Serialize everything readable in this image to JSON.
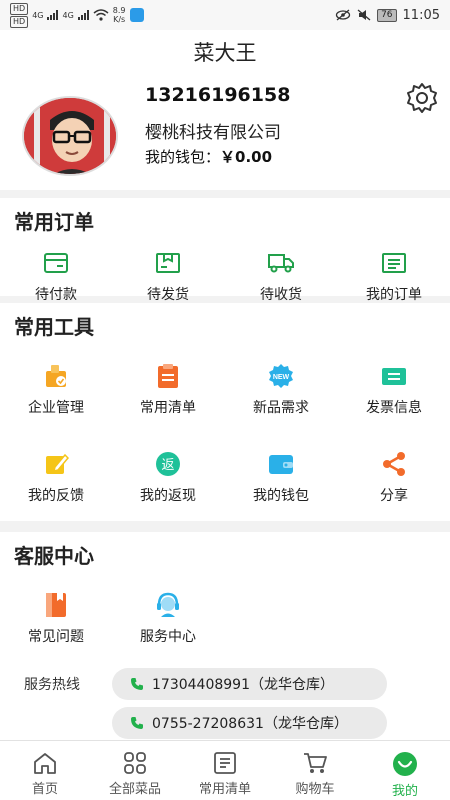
{
  "status_bar": {
    "chip1": "HD",
    "chip2": "HD",
    "net1": "4G",
    "net2": "4G",
    "speed_value": "8.9",
    "speed_unit": "K/s",
    "battery": "76",
    "time": "11:05"
  },
  "header": {
    "title": "菜大王"
  },
  "profile": {
    "phone": "13216196158",
    "company": "樱桃科技有限公司",
    "wallet_label": "我的钱包：",
    "wallet_amount": "￥0.00"
  },
  "orders": {
    "title": "常用订单",
    "items": [
      {
        "label": "待付款",
        "icon": "payment-icon"
      },
      {
        "label": "待发货",
        "icon": "package-icon"
      },
      {
        "label": "待收货",
        "icon": "truck-icon"
      },
      {
        "label": "我的订单",
        "icon": "order-list-icon"
      }
    ]
  },
  "tools": {
    "title": "常用工具",
    "items": [
      {
        "label": "企业管理",
        "icon": "enterprise-icon",
        "color": "#f5a623"
      },
      {
        "label": "常用清单",
        "icon": "clipboard-icon",
        "color": "#f26b2b"
      },
      {
        "label": "新品需求",
        "icon": "new-badge-icon",
        "color": "#2ab0e8"
      },
      {
        "label": "发票信息",
        "icon": "invoice-icon",
        "color": "#1fc199"
      },
      {
        "label": "我的反馈",
        "icon": "feedback-icon",
        "color": "#f5c518"
      },
      {
        "label": "我的返现",
        "icon": "cashback-icon",
        "color": "#1fc199"
      },
      {
        "label": "我的钱包",
        "icon": "wallet-icon",
        "color": "#2ab0e8"
      },
      {
        "label": "分享",
        "icon": "share-icon",
        "color": "#f26b2b"
      }
    ]
  },
  "service": {
    "title": "客服中心",
    "items": [
      {
        "label": "常见问题",
        "icon": "faq-book-icon",
        "color": "#f26b2b"
      },
      {
        "label": "服务中心",
        "icon": "customer-service-icon",
        "color": "#2ab0e8"
      }
    ],
    "hotline_label": "服务热线",
    "hotlines": [
      "17304408991（龙华仓库）",
      "0755-27208631（龙华仓库）"
    ]
  },
  "tab_bar": {
    "items": [
      {
        "label": "首页",
        "icon": "home-icon"
      },
      {
        "label": "全部菜品",
        "icon": "grid-icon"
      },
      {
        "label": "常用清单",
        "icon": "list-icon"
      },
      {
        "label": "购物车",
        "icon": "cart-icon"
      },
      {
        "label": "我的",
        "icon": "profile-icon"
      }
    ],
    "active_index": 4,
    "active_color": "#22b14c"
  },
  "colors": {
    "accent_green": "#22b14c",
    "order_icon_green": "#22a04b",
    "phone_icon_green": "#22b14c"
  }
}
